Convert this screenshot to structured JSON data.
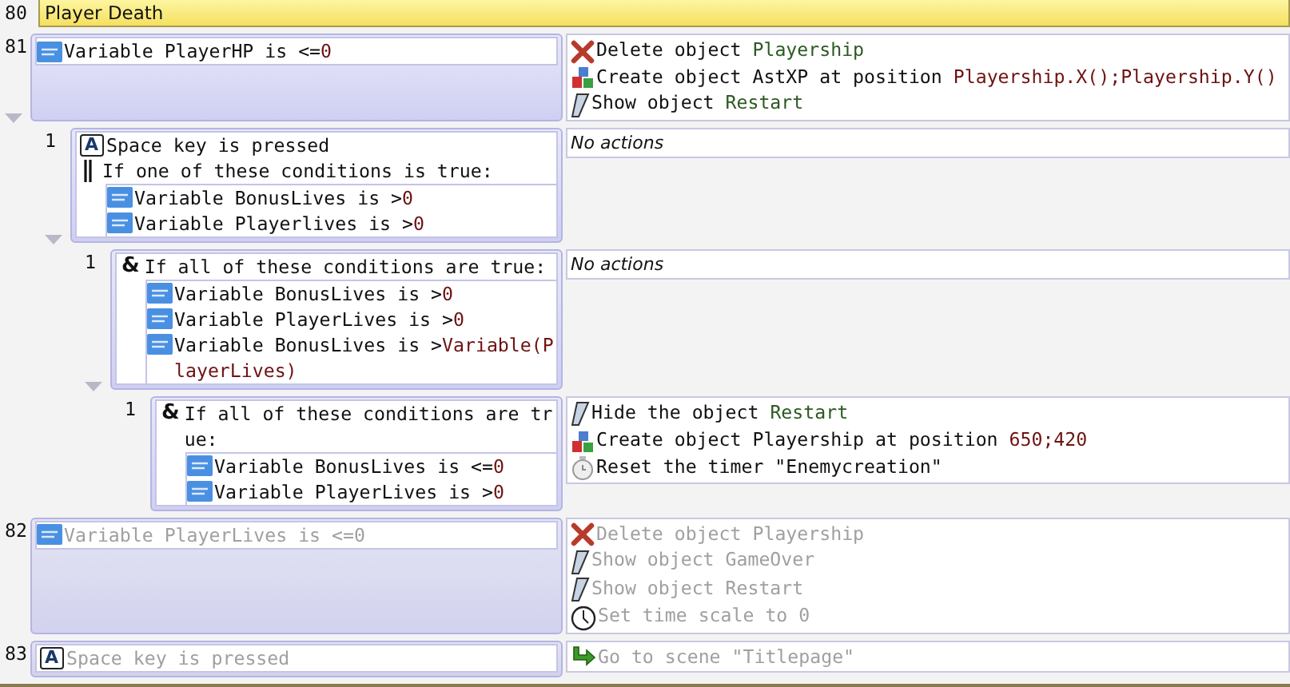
{
  "events": [
    {
      "kind": "comment",
      "number": "80",
      "text": "Player Death"
    },
    {
      "kind": "standard",
      "number": "81",
      "disabled": false,
      "expanded": true,
      "conditions": [
        {
          "kind": "variable",
          "parts": [
            {
              "text": "Variable PlayerHP is <=",
              "kind": "text"
            },
            {
              "text": "0",
              "kind": "value"
            }
          ]
        }
      ],
      "actions": [
        {
          "kind": "delete",
          "parts": [
            {
              "text": "Delete object ",
              "kind": "text"
            },
            {
              "text": "Playership",
              "kind": "object"
            }
          ]
        },
        {
          "kind": "create",
          "parts": [
            {
              "text": "Create object AstXP at position ",
              "kind": "text"
            },
            {
              "text": "Playership.X();Playership.Y()",
              "kind": "value"
            }
          ]
        },
        {
          "kind": "visibility",
          "parts": [
            {
              "text": "Show object ",
              "kind": "text"
            },
            {
              "text": "Restart",
              "kind": "object"
            }
          ]
        }
      ],
      "children": [
        {
          "kind": "standard",
          "number": "1",
          "disabled": false,
          "expanded": true,
          "conditions": [
            {
              "kind": "key",
              "glyph": "A",
              "parts": [
                {
                  "text": "Space key is pressed",
                  "kind": "text"
                }
              ]
            },
            {
              "kind": "or",
              "parts": [
                {
                  "text": "If one of these conditions is true:",
                  "kind": "text"
                }
              ],
              "sub": [
                {
                  "kind": "variable",
                  "parts": [
                    {
                      "text": "Variable BonusLives is >",
                      "kind": "text"
                    },
                    {
                      "text": "0",
                      "kind": "value"
                    }
                  ]
                },
                {
                  "kind": "variable",
                  "parts": [
                    {
                      "text": "Variable Playerlives is >",
                      "kind": "text"
                    },
                    {
                      "text": "0",
                      "kind": "value"
                    }
                  ]
                }
              ]
            }
          ],
          "actions_note": "No actions",
          "children": [
            {
              "kind": "standard",
              "number": "1",
              "disabled": false,
              "expanded": true,
              "conditions": [
                {
                  "kind": "and",
                  "glyph": "&",
                  "parts": [
                    {
                      "text": "If all of these conditions are true:",
                      "kind": "text"
                    }
                  ],
                  "sub": [
                    {
                      "kind": "variable",
                      "parts": [
                        {
                          "text": "Variable BonusLives is >",
                          "kind": "text"
                        },
                        {
                          "text": "0",
                          "kind": "value"
                        }
                      ]
                    },
                    {
                      "kind": "variable",
                      "parts": [
                        {
                          "text": "Variable PlayerLives is >",
                          "kind": "text"
                        },
                        {
                          "text": "0",
                          "kind": "value"
                        }
                      ]
                    },
                    {
                      "kind": "variable",
                      "parts": [
                        {
                          "text": "Variable BonusLives is >",
                          "kind": "text"
                        },
                        {
                          "text": "Variable(PlayerLives)",
                          "kind": "value"
                        }
                      ]
                    }
                  ]
                }
              ],
              "actions_note": "No actions",
              "children": [
                {
                  "kind": "standard",
                  "number": "1",
                  "disabled": false,
                  "conditions": [
                    {
                      "kind": "and",
                      "glyph": "&",
                      "parts": [
                        {
                          "text": "If all of these conditions are true:",
                          "kind": "text"
                        }
                      ],
                      "sub": [
                        {
                          "kind": "variable",
                          "parts": [
                            {
                              "text": "Variable BonusLives is <=",
                              "kind": "text"
                            },
                            {
                              "text": "0",
                              "kind": "value"
                            }
                          ]
                        },
                        {
                          "kind": "variable",
                          "parts": [
                            {
                              "text": "Variable PlayerLives is >",
                              "kind": "text"
                            },
                            {
                              "text": "0",
                              "kind": "value"
                            }
                          ]
                        }
                      ]
                    }
                  ],
                  "actions": [
                    {
                      "kind": "visibility",
                      "parts": [
                        {
                          "text": "Hide the object ",
                          "kind": "text"
                        },
                        {
                          "text": "Restart",
                          "kind": "object"
                        }
                      ]
                    },
                    {
                      "kind": "create",
                      "parts": [
                        {
                          "text": "Create object Playership at position ",
                          "kind": "text"
                        },
                        {
                          "text": "650;420",
                          "kind": "value"
                        }
                      ]
                    },
                    {
                      "kind": "timer",
                      "parts": [
                        {
                          "text": "Reset the timer \"Enemycreation\"",
                          "kind": "text"
                        }
                      ]
                    }
                  ]
                }
              ]
            }
          ]
        }
      ]
    },
    {
      "kind": "standard",
      "number": "82",
      "disabled": true,
      "conditions": [
        {
          "kind": "variable",
          "parts": [
            {
              "text": "Variable PlayerLives is <=",
              "kind": "text"
            },
            {
              "text": "0",
              "kind": "value"
            }
          ]
        }
      ],
      "actions": [
        {
          "kind": "delete",
          "parts": [
            {
              "text": "Delete object ",
              "kind": "text"
            },
            {
              "text": "Playership",
              "kind": "object"
            }
          ]
        },
        {
          "kind": "visibility",
          "parts": [
            {
              "text": "Show object ",
              "kind": "text"
            },
            {
              "text": "GameOver",
              "kind": "object"
            }
          ]
        },
        {
          "kind": "visibility",
          "parts": [
            {
              "text": "Show object ",
              "kind": "text"
            },
            {
              "text": "Restart",
              "kind": "object"
            }
          ]
        },
        {
          "kind": "timescale",
          "parts": [
            {
              "text": "Set time scale to ",
              "kind": "text"
            },
            {
              "text": "0",
              "kind": "value"
            }
          ]
        }
      ]
    },
    {
      "kind": "standard",
      "number": "83",
      "disabled": true,
      "conditions": [
        {
          "kind": "key",
          "glyph": "A",
          "parts": [
            {
              "text": "Space key is pressed",
              "kind": "text"
            }
          ]
        }
      ],
      "actions": [
        {
          "kind": "scene",
          "parts": [
            {
              "text": "Go to scene \"Titlepage\"",
              "kind": "text"
            }
          ]
        }
      ]
    }
  ]
}
